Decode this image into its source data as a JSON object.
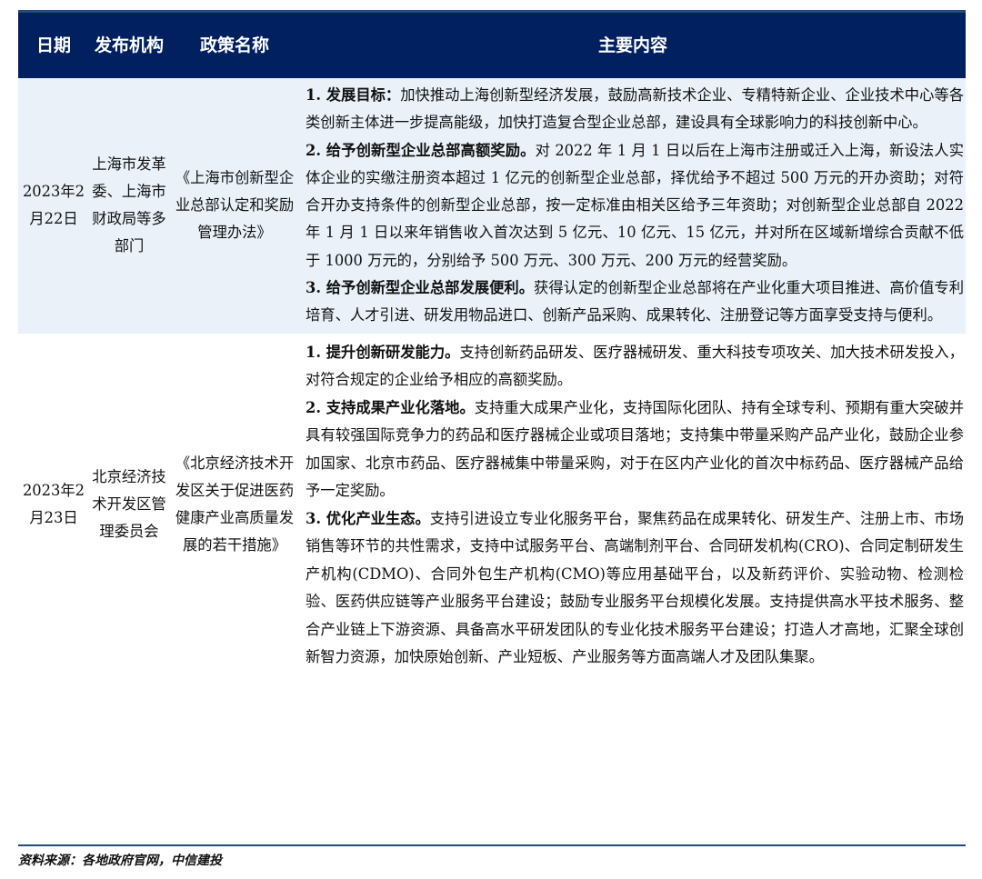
{
  "table": {
    "headers": [
      "日期",
      "发布机构",
      "政策名称",
      "主要内容"
    ],
    "rows": [
      {
        "date": "2023年2月22日",
        "org": "上海市发革委、上海市财政局等多部门",
        "policy": "《上海市创新型企业总部认定和奖励管理办法》",
        "items": [
          {
            "heading": "1. 发展目标：",
            "text": "加快推动上海创新型经济发展，鼓励高新技术企业、专精特新企业、企业技术中心等各类创新主体进一步提高能级，加快打造复合型企业总部，建设具有全球影响力的科技创新中心。"
          },
          {
            "heading": "2. 给予创新型企业总部高额奖励。",
            "text": "对 2022 年 1 月 1 日以后在上海市注册或迁入上海，新设法人实体企业的实缴注册资本超过 1 亿元的创新型企业总部，择优给予不超过 500 万元的开办资助；对符合开办支持条件的创新型企业总部，按一定标准由相关区给予三年资助；对创新型企业总部自 2022 年 1 月 1 日以来年销售收入首次达到 5 亿元、10 亿元、15 亿元，并对所在区域新增综合贡献不低于 1000 万元的，分别给予 500 万元、300 万元、200 万元的经营奖励。"
          },
          {
            "heading": "3. 给予创新型企业总部发展便利。",
            "text": "获得认定的创新型企业总部将在产业化重大项目推进、高价值专利培育、人才引进、研发用物品进口、创新产品采购、成果转化、注册登记等方面享受支持与便利。"
          }
        ]
      },
      {
        "date": "2023年2月23日",
        "org": "北京经济技术开发区管理委员会",
        "policy": "《北京经济技术开发区关于促进医药健康产业高质量发展的若干措施》",
        "items": [
          {
            "heading": "1. 提升创新研发能力。",
            "text": "支持创新药品研发、医疗器械研发、重大科技专项攻关、加大技术研发投入，对符合规定的企业给予相应的高额奖励。"
          },
          {
            "heading": "2. 支持成果产业化落地。",
            "text": "支持重大成果产业化，支持国际化团队、持有全球专利、预期有重大突破并具有较强国际竞争力的药品和医疗器械企业或项目落地；支持集中带量采购产品产业化，鼓励企业参加国家、北京市药品、医疗器械集中带量采购，对于在区内产业化的首次中标药品、医疗器械产品给予一定奖励。"
          },
          {
            "heading": "3. 优化产业生态。",
            "text": "支持引进设立专业化服务平台，聚焦药品在成果转化、研发生产、注册上市、市场销售等环节的共性需求，支持中试服务平台、高端制剂平台、合同研发机构(CRO)、合同定制研发生产机构(CDMO)、合同外包生产机构(CMO)等应用基础平台，以及新药评价、实验动物、检测检验、医药供应链等产业服务平台建设；鼓励专业服务平台规模化发展。支持提供高水平技术服务、整合产业链上下游资源、具备高水平研发团队的专业化技术服务平台建设；打造人才高地，汇聚全球创新智力资源，加快原始创新、产业短板、产业服务等方面高端人才及团队集聚。"
          }
        ]
      }
    ]
  },
  "source": "资料来源：各地政府官网，中信建投",
  "colors": {
    "header_bg": "#002060",
    "row_alt_bg": "#eaf1f9",
    "rule": "#1f4e79"
  }
}
